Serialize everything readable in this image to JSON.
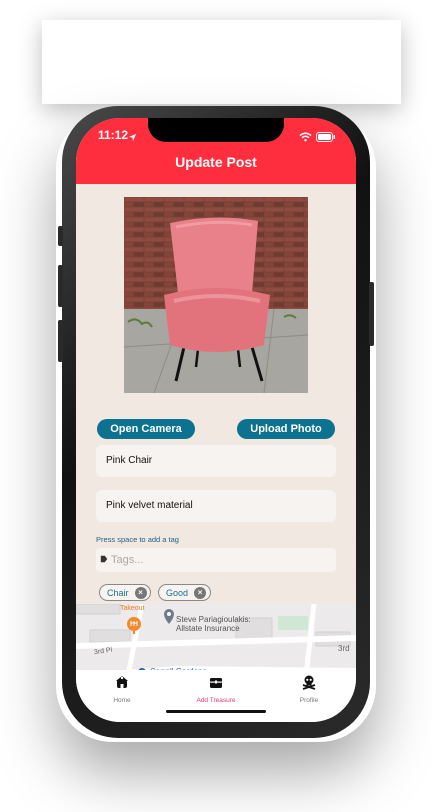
{
  "status_bar": {
    "time": "11:12"
  },
  "header": {
    "title": "Update Post"
  },
  "buttons": {
    "open_camera": "Open Camera",
    "upload_photo": "Upload Photo"
  },
  "fields": {
    "title_value": "Pink Chair",
    "description_value": "Pink velvet material"
  },
  "tags": {
    "hint": "Press space to add a tag",
    "placeholder": "Tags...",
    "chips": [
      "Chair",
      "Good"
    ]
  },
  "map": {
    "labels": {
      "takeout": "Takeout",
      "place_line1": "Steve Pariagioulakis:",
      "place_line2": "Allstate Insurance",
      "street_left": "3rd Pl",
      "street_right": "3rd",
      "neighborhood": "Carroll Gardens"
    }
  },
  "tabbar": {
    "items": [
      {
        "label": "Home",
        "icon": "home-icon"
      },
      {
        "label": "Add Treasure",
        "icon": "treasure-chest-icon"
      },
      {
        "label": "Profile",
        "icon": "skull-crossbones-icon"
      }
    ],
    "active_index": 1
  },
  "colors": {
    "header": "#ff2e3f",
    "accent_button": "#0c7290",
    "background": "#f1e8e2",
    "active_tab": "#e33a79"
  }
}
